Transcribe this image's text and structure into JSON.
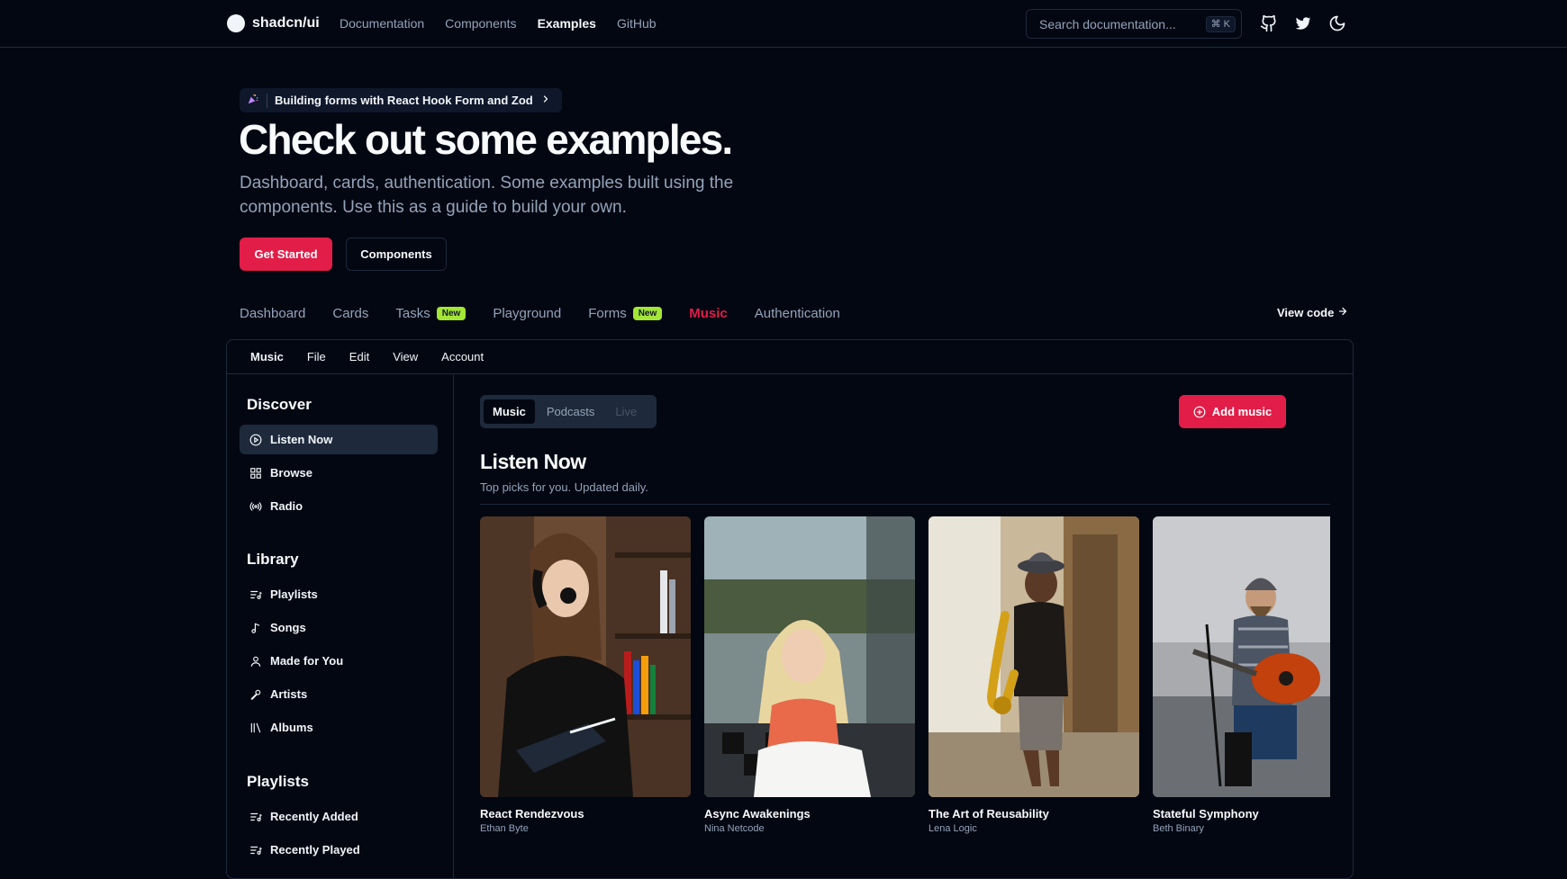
{
  "brand": {
    "name": "shadcn/ui"
  },
  "topnav": [
    "Documentation",
    "Components",
    "Examples",
    "GitHub"
  ],
  "search": {
    "placeholder": "Search documentation...",
    "shortcut": "⌘ K"
  },
  "announcement": {
    "text": "Building forms with React Hook Form and Zod"
  },
  "hero": {
    "title": "Check out some examples.",
    "subtitle": "Dashboard, cards, authentication. Some examples built using the components. Use this as a guide to build your own.",
    "primary_button": "Get Started",
    "secondary_button": "Components"
  },
  "example_tabs": [
    {
      "label": "Dashboard"
    },
    {
      "label": "Cards"
    },
    {
      "label": "Tasks",
      "badge": "New"
    },
    {
      "label": "Playground"
    },
    {
      "label": "Forms",
      "badge": "New"
    },
    {
      "label": "Music",
      "active": true
    },
    {
      "label": "Authentication"
    }
  ],
  "view_code": "View code",
  "menubar": [
    "Music",
    "File",
    "Edit",
    "View",
    "Account"
  ],
  "sidebar": {
    "discover": {
      "heading": "Discover",
      "items": [
        "Listen Now",
        "Browse",
        "Radio"
      ]
    },
    "library": {
      "heading": "Library",
      "items": [
        "Playlists",
        "Songs",
        "Made for You",
        "Artists",
        "Albums"
      ]
    },
    "playlists": {
      "heading": "Playlists",
      "items": [
        "Recently Added",
        "Recently Played"
      ]
    }
  },
  "main": {
    "segments": [
      "Music",
      "Podcasts",
      "Live"
    ],
    "add_button": "Add music",
    "title": "Listen Now",
    "subtitle": "Top picks for you. Updated daily.",
    "albums": [
      {
        "title": "React Rendezvous",
        "artist": "Ethan Byte"
      },
      {
        "title": "Async Awakenings",
        "artist": "Nina Netcode"
      },
      {
        "title": "The Art of Reusability",
        "artist": "Lena Logic"
      },
      {
        "title": "Stateful Symphony",
        "artist": "Beth Binary"
      }
    ]
  },
  "colors": {
    "accent": "#e11d48",
    "badge": "#a3e635",
    "background": "#030712",
    "muted": "#94a3b8",
    "border": "#1e293b"
  }
}
